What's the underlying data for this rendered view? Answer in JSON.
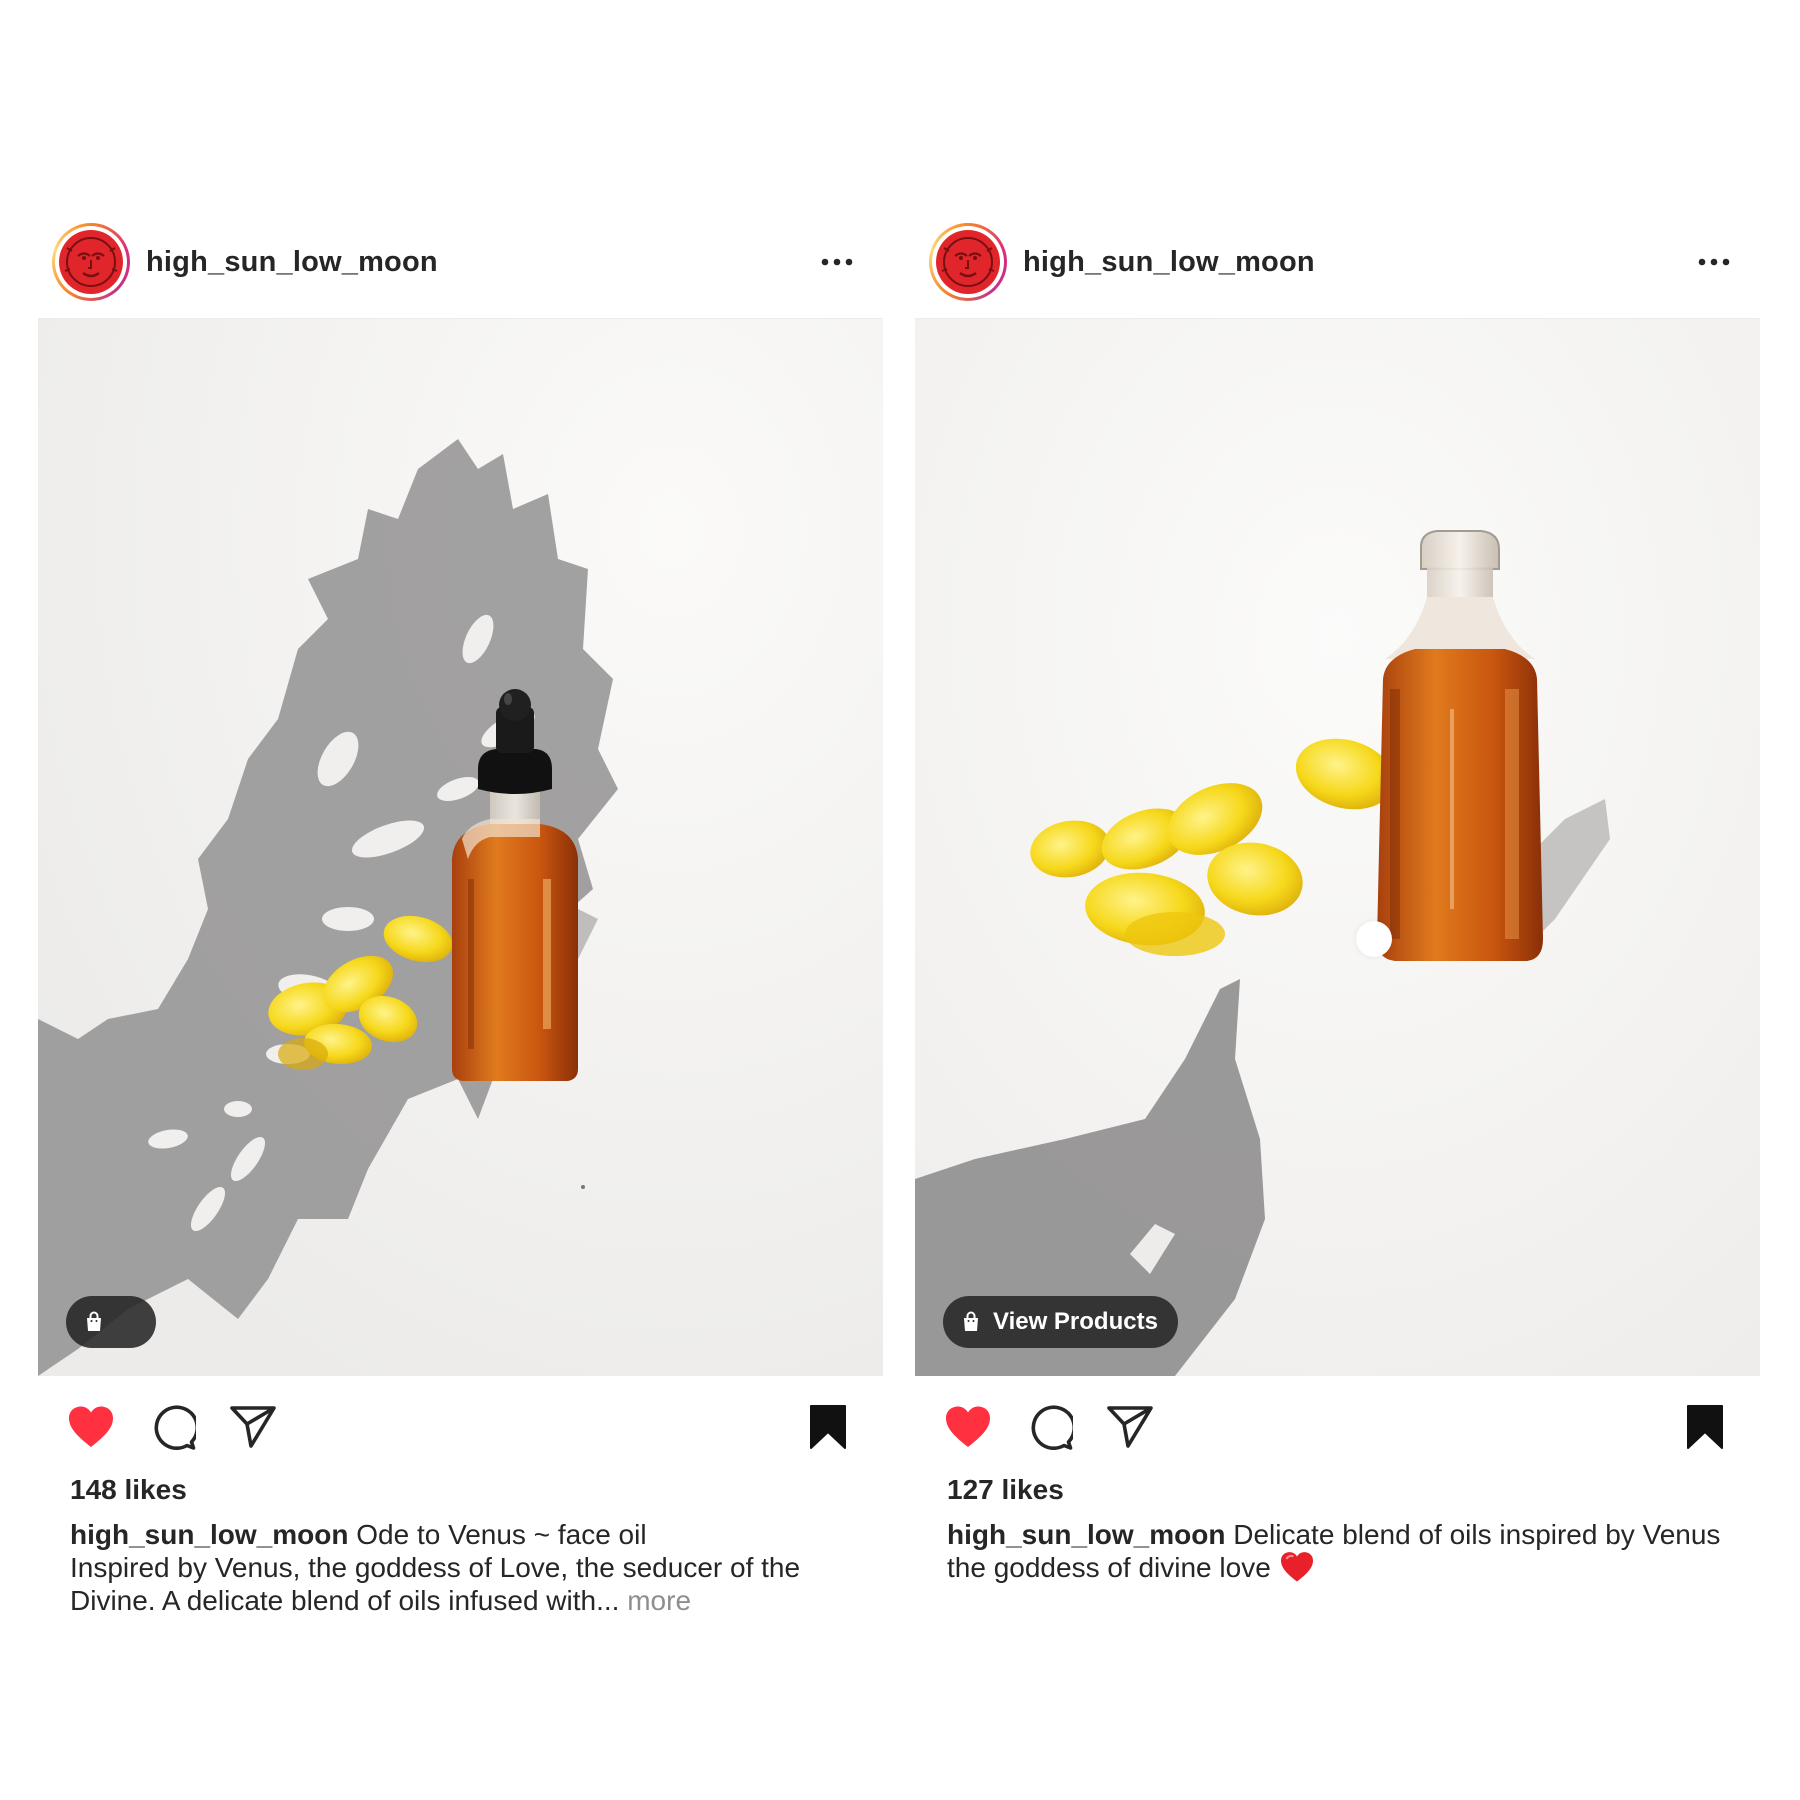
{
  "colors": {
    "like_red": "#ff3040",
    "text": "#262626",
    "muted": "#8e8e8e",
    "pill_bg": "#262626"
  },
  "posts": [
    {
      "username": "high_sun_low_moon",
      "avatar_icon": "sun-face-logo",
      "more_icon": "more-dots-icon",
      "liked": true,
      "saved": true,
      "shop_pill_label": "",
      "likes": "148 likes",
      "caption_user": "high_sun_low_moon",
      "caption_title": "Ode to Venus ~ face oil",
      "caption_body": "Inspired by Venus, the goddess of Love, the seducer of the Divine. A delicate blend of oils infused with...",
      "more_label": "more"
    },
    {
      "username": "high_sun_low_moon",
      "avatar_icon": "sun-face-logo",
      "more_icon": "more-dots-icon",
      "liked": true,
      "saved": true,
      "shop_pill_label": "View Products",
      "likes": "127 likes",
      "caption_user": "high_sun_low_moon",
      "caption_text": "Delicate blend of oils inspired by Venus the goddess of divine love",
      "caption_emoji": "❤️"
    }
  ]
}
